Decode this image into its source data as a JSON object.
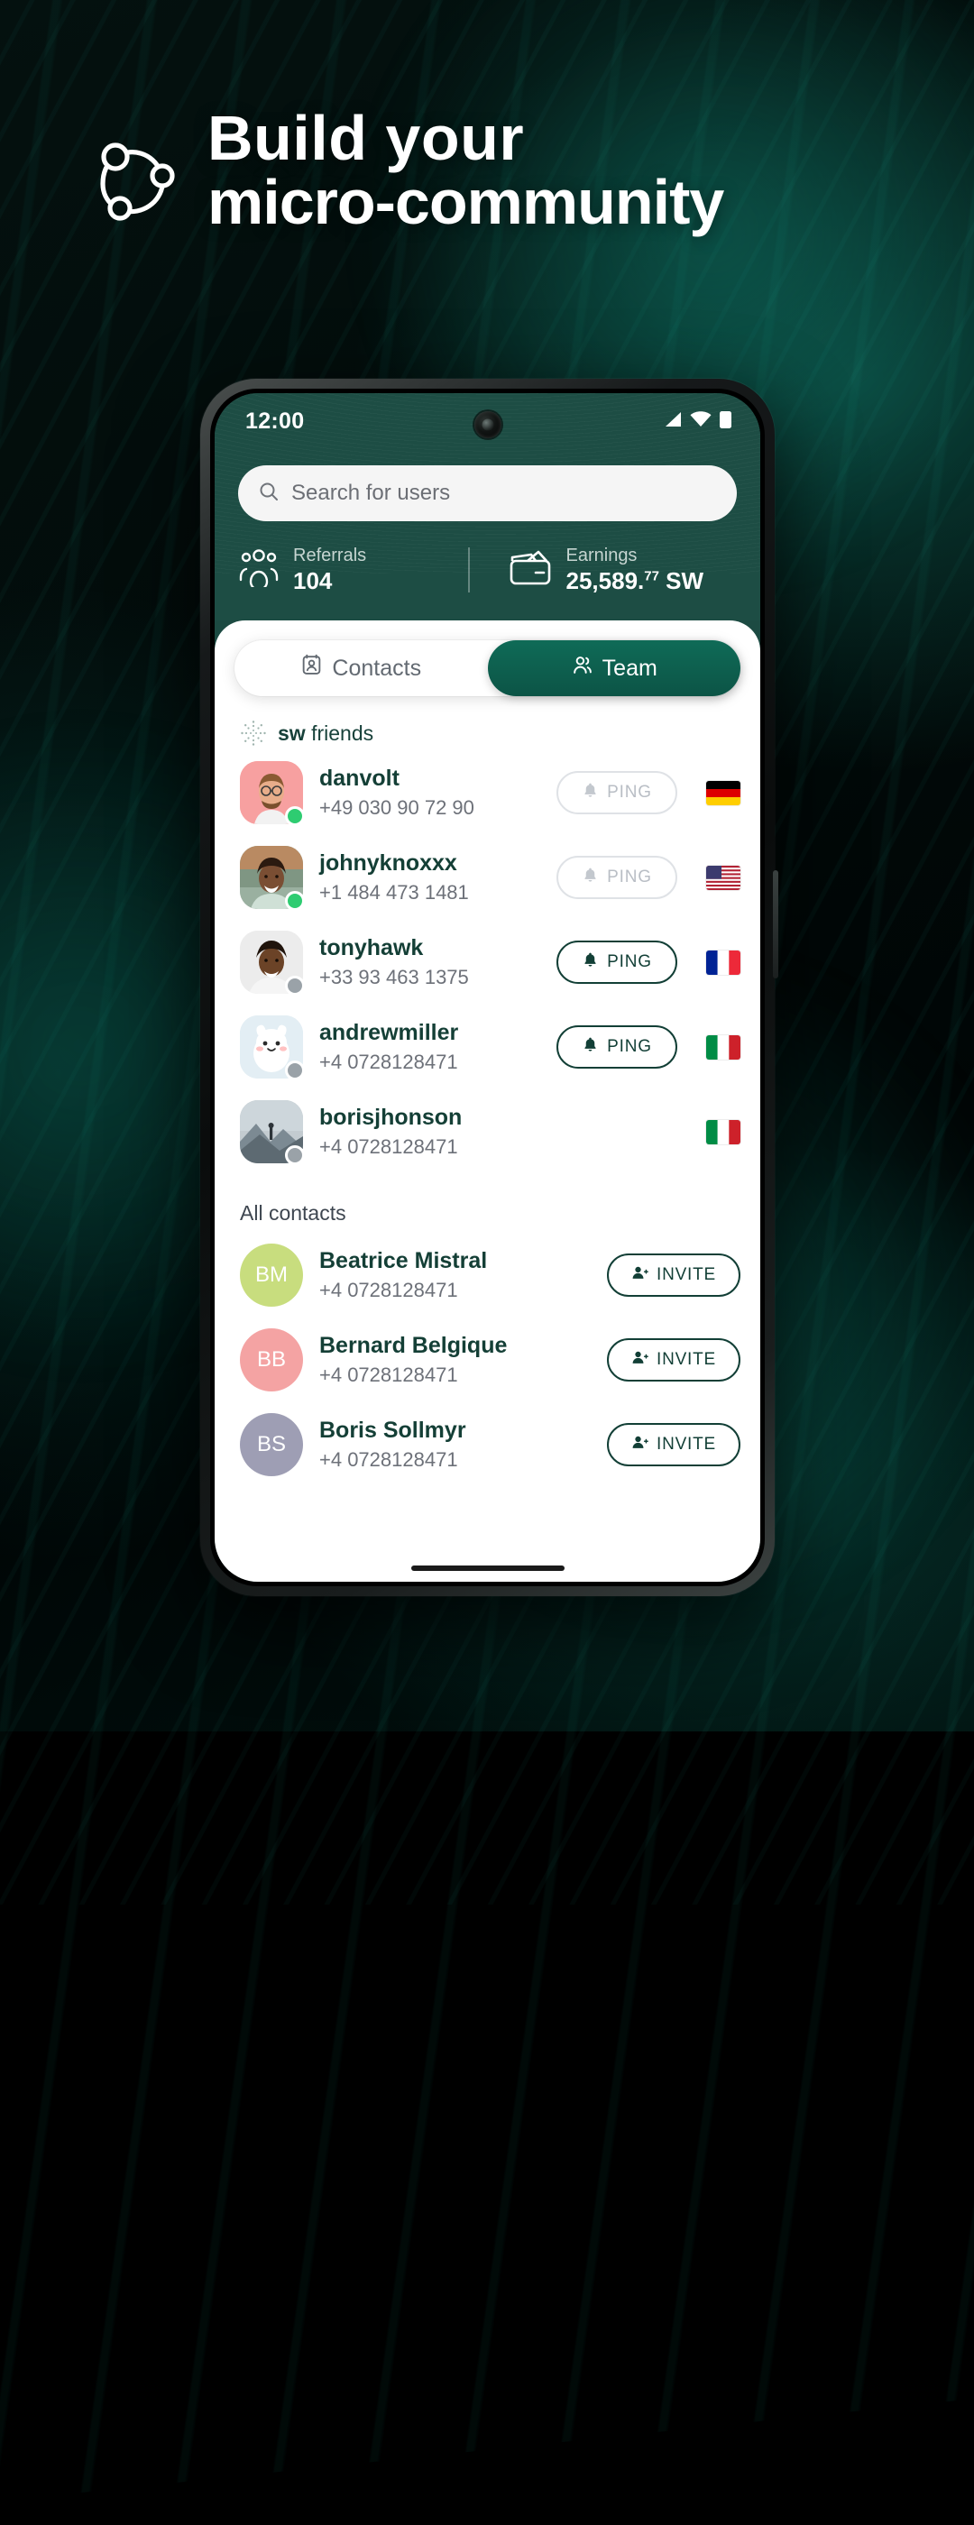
{
  "hero": {
    "logo_icon": "community-network-icon",
    "line1": "Build your",
    "line2": "micro-community"
  },
  "phone": {
    "statusbar": {
      "time": "12:00",
      "icons": [
        "signal-icon",
        "wifi-icon",
        "battery-icon"
      ]
    },
    "search": {
      "icon": "search-icon",
      "placeholder": "Search for users",
      "value": ""
    },
    "stats": [
      {
        "icon": "referrals-group-icon",
        "label": "Referrals",
        "value": "104",
        "cents": "",
        "currency": ""
      },
      {
        "icon": "wallet-icon",
        "label": "Earnings",
        "value": "25,589.",
        "cents": "77",
        "currency": " SW"
      }
    ],
    "tabs": [
      {
        "id": "contacts",
        "label": "Contacts",
        "icon": "contact-card-icon",
        "active": false
      },
      {
        "id": "team",
        "label": "Team",
        "icon": "people-icon",
        "active": true
      }
    ],
    "sections": [
      {
        "id": "sw-friends",
        "icon": "dotted-burst-icon",
        "title_bold": "sw",
        "title_rest": " friends",
        "rows": [
          {
            "name": "danvolt",
            "phone": "+49 030 90 72 90",
            "status": "online",
            "avatar": "photo-man-glasses",
            "action": {
              "type": "ping",
              "label": "PING",
              "icon": "bell-icon",
              "enabled": false
            },
            "flag": "DE"
          },
          {
            "name": "johnyknoxxx",
            "phone": "+1 484 473 1481",
            "status": "online",
            "avatar": "photo-woman-smiling",
            "action": {
              "type": "ping",
              "label": "PING",
              "icon": "bell-icon",
              "enabled": false
            },
            "flag": "US"
          },
          {
            "name": "tonyhawk",
            "phone": "+33 93 463 1375",
            "status": "offline",
            "avatar": "photo-man-curly",
            "action": {
              "type": "ping",
              "label": "PING",
              "icon": "bell-icon",
              "enabled": true
            },
            "flag": "FR"
          },
          {
            "name": "andrewmiller",
            "phone": "+4 0728128471",
            "status": "offline",
            "avatar": "illustration-yeti",
            "action": {
              "type": "ping",
              "label": "PING",
              "icon": "bell-icon",
              "enabled": true
            },
            "flag": "IT"
          },
          {
            "name": "borisjhonson",
            "phone": "+4 0728128471",
            "status": "offline",
            "avatar": "photo-mountain",
            "action": {
              "type": "none",
              "label": "",
              "icon": "",
              "enabled": false
            },
            "flag": "IT"
          }
        ]
      },
      {
        "id": "all-contacts",
        "icon": "",
        "title_bold": "",
        "title_rest": "All contacts",
        "rows": [
          {
            "name": "Beatrice Mistral",
            "phone": "+4 0728128471",
            "initials": "BM",
            "avatar_color": "#c8dd7e",
            "action": {
              "type": "invite",
              "label": "INVITE",
              "icon": "add-person-icon",
              "enabled": true
            }
          },
          {
            "name": "Bernard Belgique",
            "phone": "+4 0728128471",
            "initials": "BB",
            "avatar_color": "#f4a3a3",
            "action": {
              "type": "invite",
              "label": "INVITE",
              "icon": "add-person-icon",
              "enabled": true
            }
          },
          {
            "name": "Boris Sollmyr",
            "phone": "+4 0728128471",
            "initials": "BS",
            "avatar_color": "#9e9eb4",
            "action": {
              "type": "invite",
              "label": "INVITE",
              "icon": "add-person-icon",
              "enabled": true
            }
          }
        ]
      }
    ]
  },
  "colors": {
    "brand_green": "#0f6b57",
    "header_green": "#1d4d44",
    "text_dark": "#143f36",
    "muted": "#6d7179",
    "online": "#2ecc71",
    "offline": "#9aa2a8"
  }
}
